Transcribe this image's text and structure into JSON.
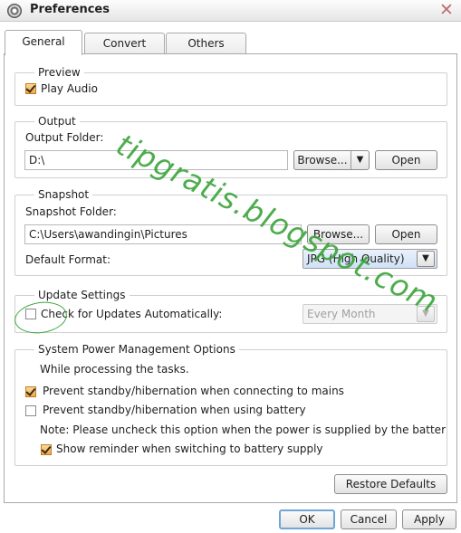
{
  "window": {
    "title": "Preferences",
    "close_symbol": "✕"
  },
  "tabs": [
    {
      "label": "General",
      "active": true
    },
    {
      "label": "Convert",
      "active": false
    },
    {
      "label": "Others",
      "active": false
    }
  ],
  "preview": {
    "legend": "Preview",
    "play_audio": {
      "label": "Play Audio",
      "checked": true
    }
  },
  "output": {
    "legend": "Output",
    "folder_label": "Output Folder:",
    "folder_value": "D:\\",
    "browse_label": "Browse...",
    "browse_arrow": "▼",
    "open_label": "Open"
  },
  "snapshot": {
    "legend": "Snapshot",
    "folder_label": "Snapshot Folder:",
    "folder_value": "C:\\Users\\awandingin\\Pictures",
    "browse_label": "Browse...",
    "open_label": "Open",
    "format_label": "Default Format:",
    "format_value": "JPG (High Quality)",
    "format_arrow": "▼"
  },
  "update": {
    "legend": "Update Settings",
    "check_label": "Check for Updates Automatically:",
    "checked": false,
    "frequency_value": "Every Month",
    "frequency_arrow": "▼"
  },
  "power": {
    "legend": "System Power Management Options",
    "intro": "While processing the tasks.",
    "prevent_mains": {
      "label": "Prevent standby/hibernation when connecting to mains",
      "checked": true
    },
    "prevent_battery": {
      "label": "Prevent standby/hibernation when using battery",
      "checked": false
    },
    "note": "Note: Please uncheck this option when the power is supplied by the battery to",
    "reminder": {
      "label": "Show reminder when switching to battery supply",
      "checked": true
    }
  },
  "restore_defaults_label": "Restore Defaults",
  "footer": {
    "ok_label": "OK",
    "cancel_label": "Cancel",
    "apply_label": "Apply"
  },
  "watermark": "tipgratis.blogspot.com",
  "colors": {
    "watermark": "#3aa53a",
    "checkbox_checked": "#f0a748",
    "default_button_border": "#6fa6d6"
  }
}
